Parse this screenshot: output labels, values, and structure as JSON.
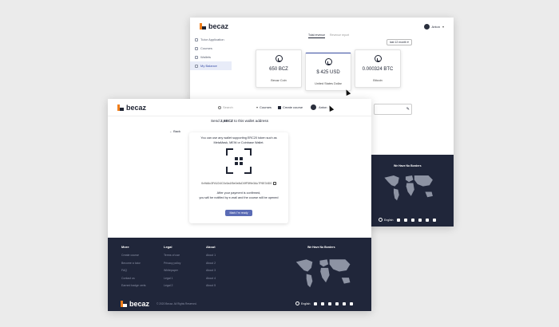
{
  "back_window": {
    "logo_text": "becaz",
    "user_name": "Anton",
    "sidebar": [
      {
        "label": "Tutor Application",
        "icon": "document-icon"
      },
      {
        "label": "Courses",
        "icon": "book-icon"
      },
      {
        "label": "Wallets",
        "icon": "wallet-icon"
      },
      {
        "label": "My Balance",
        "icon": "balance-icon",
        "active": true
      }
    ],
    "tabs": [
      "Total revenue",
      "Revenue report"
    ],
    "period": "last 12 month",
    "balances": [
      {
        "amount": "650 BCZ",
        "name": "Becaz Coin"
      },
      {
        "amount": "$ 425 USD",
        "name": "United States Dollar"
      },
      {
        "amount": "0.000324 BTC",
        "name": "Bitcoin"
      }
    ],
    "map_title": "We Have No Borders",
    "language": "English"
  },
  "front_window": {
    "logo_text": "becaz",
    "search_placeholder": "Search",
    "courses_label": "Courses",
    "create_course_label": "Create course",
    "user_name": "Anton",
    "send_prefix": "Send",
    "send_amount": "2,6BCZ",
    "send_suffix": "to this wallet address",
    "back_label": "Back",
    "wallet_desc": "You can use any wallet supporting ERC20 token such as MetaMask, MEW or Coinbase Wallet.",
    "wallet_address": "0x9A6c3FA1D4C0c5a1f5e0e8cD0fF5f9e3Ac7F6E34D0",
    "notice_1": "After your payment is confirmed,",
    "notice_2": "you will be notified by e-mail and the course will be opened",
    "confirm_button": "Mark I'm ready",
    "footer": {
      "columns": [
        {
          "title": "More",
          "links": [
            "Create course",
            "Become a tutor",
            "FAQ",
            "Contact us",
            "Earned badge certs"
          ]
        },
        {
          "title": "Legal",
          "links": [
            "Terms of use",
            "Privacy policy",
            "Whitepaper",
            "Legal 1",
            "Legal 2"
          ]
        },
        {
          "title": "About",
          "links": [
            "About 1",
            "About 2",
            "About 3",
            "About 4",
            "About 5"
          ]
        }
      ],
      "map_title": "We Have No Borders",
      "copyright": "© 2020 Becaz. All Rights Reserved.",
      "language": "English"
    }
  }
}
